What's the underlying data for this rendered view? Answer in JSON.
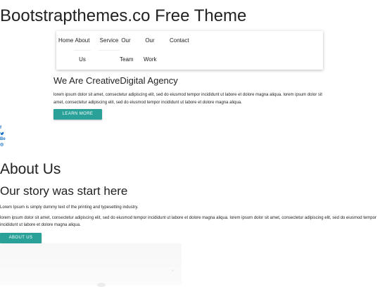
{
  "site": {
    "title": "Bootstrapthemes.co Free Theme"
  },
  "nav": {
    "home": "Home",
    "about": "About",
    "us": "Us",
    "service": "Service",
    "our_a": "Our",
    "team": "Team",
    "our_b": "Our",
    "work": "Work",
    "contact": "Contact"
  },
  "hero": {
    "heading": "We Are CreativeDigital Agency",
    "text": "lorem ipsum dolor sit amet, consectetur adipiscing elit, sed do eiusmod tempor incididunt ut labore et dolore magna aliqua. lorem ipsum dolor sit amet, consectetur adipiscing elit, sed do eiusmod tempor incididunt ut labore et dolore magna aliqua.",
    "button": "LEARN MORE"
  },
  "social": {
    "facebook": "f",
    "twitter": "t",
    "behance": "Be",
    "dribbble": "◎"
  },
  "about": {
    "title": "About Us",
    "subtitle": "Our story was start here",
    "lead": "Lorem Ipsum is simply dummy text of the printing and typesetting industry.",
    "text": "lorem ipsum dolor sit amet, consectetur adipiscing elit, sed do eiusmod tempor incididunt ut labore et dolore magna aliqua. lorem ipsum dolor sit amet, consectetur adipiscing elit, sed do eiusmod tempor incididunt ut labore et dolore magna aliqua.",
    "button": "ABOUT US"
  },
  "colors": {
    "accent": "#2aa198",
    "social": "#1a73c8"
  }
}
